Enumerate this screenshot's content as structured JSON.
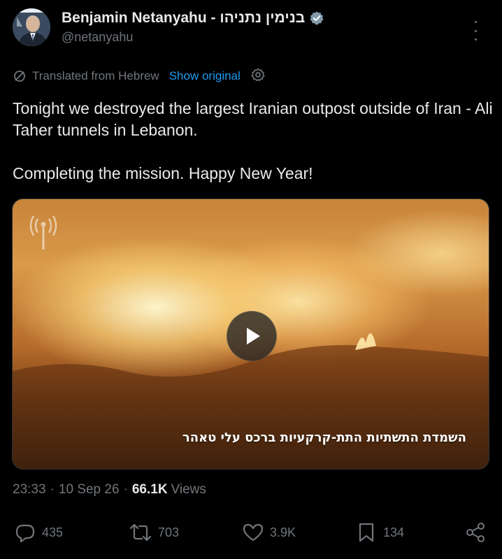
{
  "post": {
    "author": {
      "display_name": "Benjamin Netanyahu - בנימין נתניהו",
      "handle": "@netanyahu",
      "verified_icon": "verified-badge-icon"
    },
    "translation": {
      "label": "Translated from Hebrew",
      "show_original": "Show original"
    },
    "text": {
      "line1": "Tonight we destroyed the largest Iranian outpost outside of Iran - Ali Taher tunnels in Lebanon.",
      "line2": "Completing the mission. Happy New Year!"
    },
    "media": {
      "caption": "השמדת התשתיות התת-קרקעיות ברכס עלי טאהר",
      "play_icon": "play-icon"
    },
    "meta": {
      "time": "23:33",
      "date": "10 Sep 26",
      "views_count": "66.1K",
      "views_label": "Views"
    },
    "actions": {
      "replies": "435",
      "reposts": "703",
      "likes": "3.9K",
      "bookmarks": "134"
    }
  },
  "colors": {
    "background": "#000000",
    "text": "#e7e9ea",
    "muted": "#71767b",
    "link": "#1d9bf0"
  }
}
